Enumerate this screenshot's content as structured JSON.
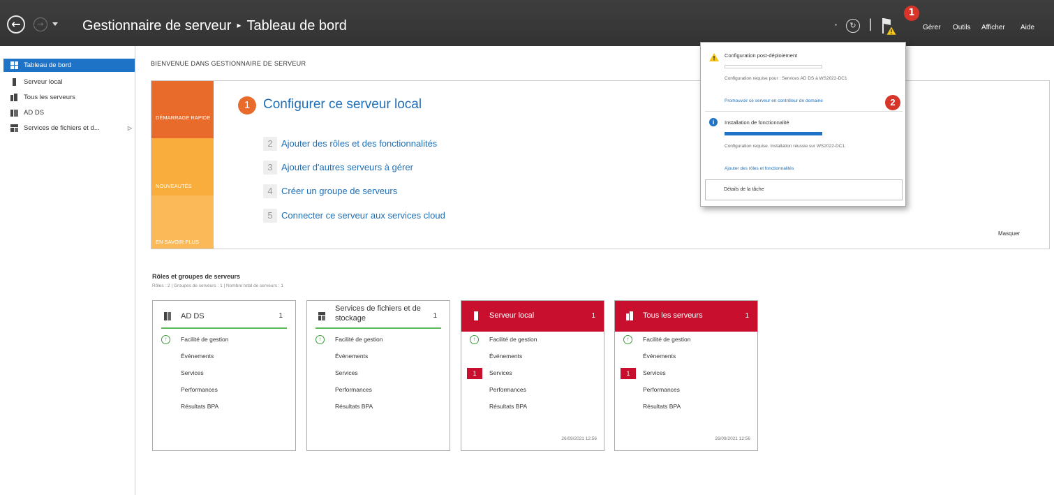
{
  "header": {
    "app_name": "Gestionnaire de serveur",
    "separator": "▸",
    "page": "Tableau de bord",
    "badge_1": "1",
    "menus": [
      "Gérer",
      "Outils",
      "Afficher",
      "Aide"
    ]
  },
  "sidebar": {
    "items": [
      {
        "label": "Tableau de bord"
      },
      {
        "label": "Serveur local"
      },
      {
        "label": "Tous les serveurs"
      },
      {
        "label": "AD DS"
      },
      {
        "label": "Services de fichiers et d..."
      }
    ]
  },
  "welcome": "BIENVENUE DANS GESTIONNAIRE DE SERVEUR",
  "quickstart": {
    "tiles": [
      "DÉMARRAGE RAPIDE",
      "NOUVEAUTÉS",
      "EN SAVOIR PLUS"
    ],
    "main_num": "1",
    "main_step": "Configurer ce serveur local",
    "steps": [
      {
        "num": "2",
        "label": "Ajouter des rôles et des fonctionnalités"
      },
      {
        "num": "3",
        "label": "Ajouter d'autres serveurs à gérer"
      },
      {
        "num": "4",
        "label": "Créer un groupe de serveurs"
      },
      {
        "num": "5",
        "label": "Connecter ce serveur aux services cloud"
      }
    ],
    "hide": "Masquer"
  },
  "popup": {
    "n1_title": "Configuration post-déploiement",
    "n1_text": "Configuration requise pour : Services AD DS à WS2022-DC1",
    "n1_link": "Promouvoir ce serveur en contrôleur de domaine",
    "badge_2": "2",
    "n2_title": "Installation de fonctionnalité",
    "n2_progress": 1.0,
    "n2_text": "Configuration requise. Installation réussie sur WS2022-DC1.",
    "n2_link": "Ajouter des rôles et fonctionnalités",
    "task_details": "Détails de la tâche"
  },
  "roles": {
    "title": "Rôles et groupes de serveurs",
    "subtitle": "Rôles : 2  |  Groupes de serveurs : 1  |  Nombre total de serveurs : 1",
    "cards": [
      {
        "title": "AD DS",
        "count": "1",
        "rows": [
          "Facilité de gestion",
          "Événements",
          "Services",
          "Performances",
          "Résultats BPA"
        ],
        "date": ""
      },
      {
        "title": "Services de fichiers et de stockage",
        "count": "1",
        "rows": [
          "Facilité de gestion",
          "Événements",
          "Services",
          "Performances",
          "Résultats BPA"
        ],
        "date": ""
      },
      {
        "title": "Serveur local",
        "count": "1",
        "rows": [
          "Facilité de gestion",
          "Événements",
          "Services",
          "Performances",
          "Résultats BPA"
        ],
        "services_badge": "1",
        "date": "26/09/2021 12:56"
      },
      {
        "title": "Tous les serveurs",
        "count": "1",
        "rows": [
          "Facilité de gestion",
          "Événements",
          "Services",
          "Performances",
          "Résultats BPA"
        ],
        "services_badge": "1",
        "date": "26/09/2021 12:56"
      }
    ]
  },
  "colors": {
    "accent": "#1e73c6",
    "alert_red": "#c8102e",
    "ok_green": "#5cb85c",
    "quickstart_orange": "#e86b2b",
    "tile_yellow": "#f9ad3c"
  }
}
